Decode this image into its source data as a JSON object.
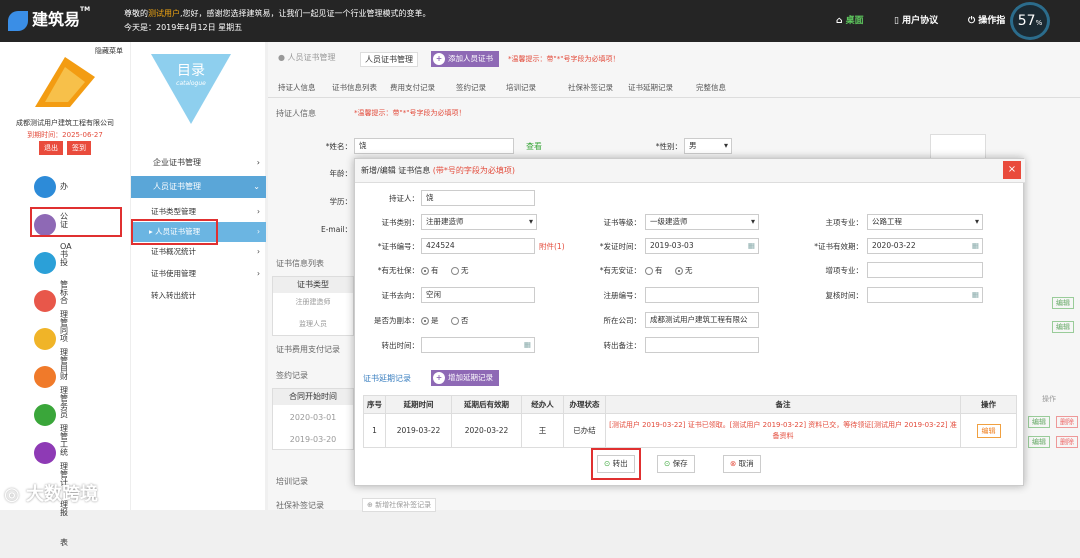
{
  "header": {
    "app_name": "建筑易",
    "trademark": "TM",
    "greeting_pre": "尊敬的",
    "greeting_user": "测试用户",
    "greeting_post": ",您好，感谢您选择建筑易，让我们一起见证一个行业管理模式的变革。",
    "today": "今天是：2019年4月12日 星期五",
    "nav_desktop": "桌面",
    "nav_agreement": "用户协议",
    "nav_guide": "操作指",
    "speed": "57",
    "speed_unit": "%"
  },
  "left": {
    "hide_menu": "隐藏菜单",
    "company": "成都测试用户建筑工程有限公司",
    "expire": "到期时间：2025-06-27",
    "logout": "退出",
    "checkin": "签到",
    "items": [
      {
        "label": "办公OA",
        "icon": "monitor-icon",
        "color": "#2d8bd8"
      },
      {
        "label": "证书管理",
        "icon": "certificate-icon",
        "color": "#8e69b5"
      },
      {
        "label": "投标管理",
        "icon": "bid-icon",
        "color": "#2ba0d8"
      },
      {
        "label": "合同管理",
        "icon": "briefcase-icon",
        "color": "#e8574a"
      },
      {
        "label": "项目管理",
        "icon": "project-icon",
        "color": "#f0b428"
      },
      {
        "label": "财务管理",
        "icon": "finance-icon",
        "color": "#f07a2a"
      },
      {
        "label": "员工管理",
        "icon": "staff-icon",
        "color": "#3aa63a"
      },
      {
        "label": "统计报表",
        "icon": "report-icon",
        "color": "#8e3ab5"
      }
    ]
  },
  "catalog": {
    "title": "目录",
    "subtitle": "catalogue",
    "menus": [
      {
        "label": "企业证书管理"
      },
      {
        "label": "人员证书管理"
      }
    ],
    "subs": [
      "证书类型管理",
      "人员证书管理",
      "证书概况统计",
      "证书使用管理",
      "转入转出统计"
    ]
  },
  "main": {
    "breadcrumb": "人员证书管理",
    "bc_tab": "人员证书管理",
    "add_cert": "添加人员证书",
    "tip_top": "*温馨提示：带\"*\"号字段为必填项！",
    "tabs": [
      "持证人信息",
      "证书信息列表",
      "费用支付记录",
      "签约记录",
      "培训记录",
      "社保补签记录",
      "证书延期记录",
      "完整信息"
    ],
    "holder_info": "持证人信息",
    "tip_info": "*温馨提示：带\"*\"号字段为必填项！",
    "name_label": "*姓名：",
    "name_value": "饶",
    "view": "查看",
    "gender_label": "*性别：",
    "gender_value": "男",
    "age_label": "年龄：",
    "edu_label": "学历：",
    "email_label": "E-mail：",
    "cert_list": "证书信息列表",
    "cert_type_col": "证书类型",
    "row1": "注册建造师",
    "row2": "监理人员",
    "fee_record": "证书费用支付记录",
    "sign_record": "签约记录",
    "contract_start": "合同开始时间",
    "date1": "2020-03-01",
    "date2": "2019-03-20",
    "training": "培训记录",
    "social": "社保补签记录",
    "new_social": "新增社保补签记录",
    "op": "操作",
    "edit": "编辑",
    "delete": "删除"
  },
  "dialog": {
    "title": "新增/编辑 证书信息",
    "req_note": "(带*号的字段为必填项)",
    "holder_label": "持证人：",
    "holder_value": "饶",
    "cert_type_label": "证书类别：",
    "cert_type_value": "注册建造师",
    "cert_level_label": "证书等级：",
    "cert_level_value": "一级建造师",
    "major_label": "主项专业：",
    "major_value": "公路工程",
    "cert_no_label": "*证书编号：",
    "cert_no_value": "424524",
    "attach": "附件(1)",
    "issue_label": "*发证时间：",
    "issue_value": "2019-03-03",
    "valid_label": "*证书有效期：",
    "valid_value": "2020-03-22",
    "social_label": "*有无社保：",
    "social_yes": "有",
    "social_no": "无",
    "safety_label": "*有无安证：",
    "safety_yes": "有",
    "safety_no": "无",
    "extra_major_label": "增项专业：",
    "dest_label": "证书去向：",
    "dest_value": "空闲",
    "reg_no_label": "注册编号：",
    "review_label": "复核时间：",
    "copy_label": "是否为副本：",
    "copy_yes": "是",
    "copy_no": "否",
    "company_label": "所在公司：",
    "company_value": "成都测试用户建筑工程有限公",
    "out_time_label": "转出时间：",
    "out_note_label": "转出备注：",
    "extend_title": "证书延期记录",
    "extend_add": "增加延期记录",
    "table_headers": [
      "序号",
      "延期时间",
      "延期后有效期",
      "经办人",
      "办理状态",
      "备注",
      "操作"
    ],
    "table_rows": [
      {
        "no": "1",
        "time": "2019-03-22",
        "after": "2020-03-22",
        "handler": "王",
        "status": "已办结",
        "note": "[测试用户 2019-03-22] 证书已领取。[测试用户 2019-03-22] 资料已交，等待领证[测试用户 2019-03-22] 准备资料",
        "op": "编辑"
      }
    ],
    "btn_out": "转出",
    "btn_save": "保存",
    "btn_cancel": "取消"
  },
  "watermark": "大数跨境"
}
